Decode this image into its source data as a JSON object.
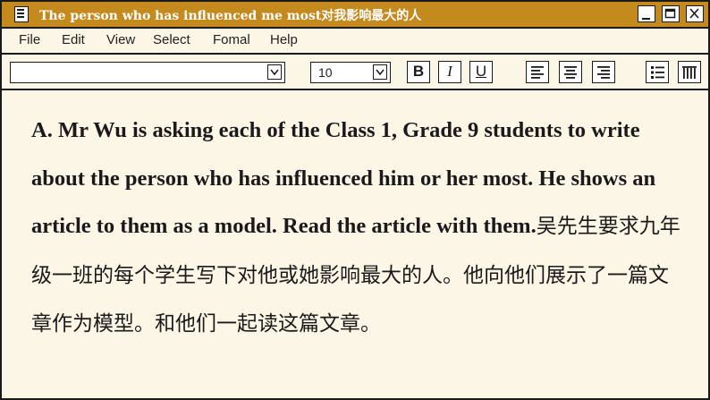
{
  "window": {
    "title": "The person who has influenced me most对我影响最大的人",
    "controls": [
      "minimize-icon",
      "maximize-icon",
      "close-icon"
    ]
  },
  "menu": [
    "File",
    "Edit",
    "View",
    "Select",
    "Fomal",
    "Help"
  ],
  "toolbar": {
    "font_name": "",
    "font_size": "10",
    "bold": "B",
    "italic": "I",
    "underline": "U",
    "icons": [
      "align-left-icon",
      "align-center-icon",
      "align-right-icon",
      "bullet-list-icon",
      "columns-icon"
    ]
  },
  "document": {
    "english": "A. Mr Wu is asking each of the Class 1, Grade 9 students to write about the person who has influenced him or her most. He shows an article to them as a model. Read the article with them.",
    "chinese": "吴先生要求九年级一班的每个学生写下对他或她影响最大的人。他向他们展示了一篇文章作为模型。和他们一起读这篇文章。"
  },
  "colors": {
    "titlebar": "#c48a1e",
    "background": "#fcf6e6",
    "border": "#1a1a1a"
  }
}
